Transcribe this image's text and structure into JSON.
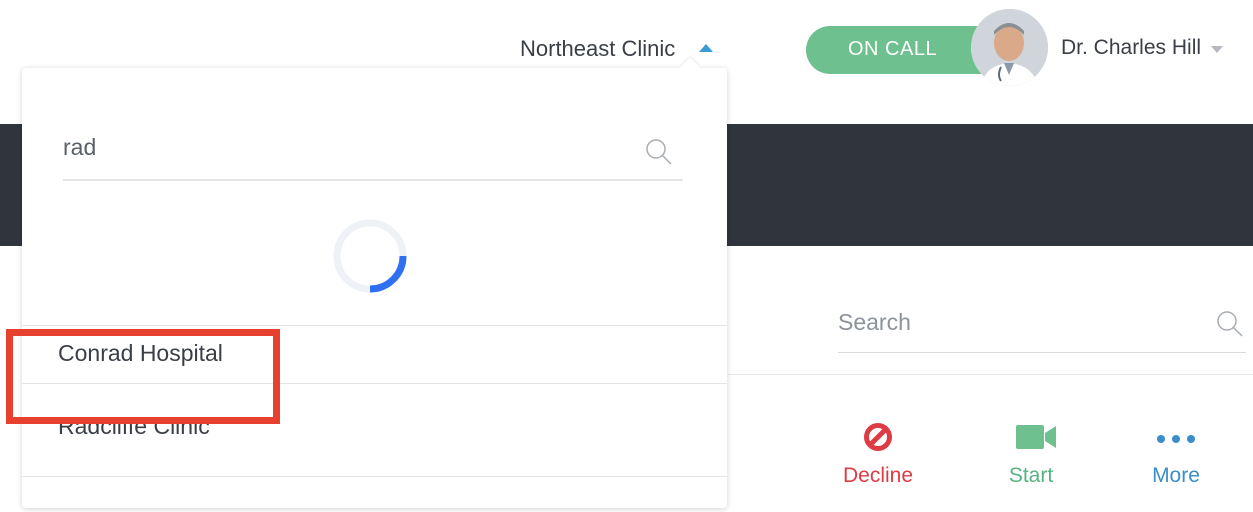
{
  "header": {
    "clinic_selector": {
      "selected": "Northeast Clinic"
    },
    "on_call_label": "ON CALL",
    "user_name": "Dr. Charles Hill"
  },
  "clinic_dropdown": {
    "search_value": "rad",
    "options": [
      {
        "label": "Conrad Hospital"
      },
      {
        "label": "Radcliffe Clinic"
      }
    ]
  },
  "main": {
    "search": {
      "placeholder": "Search"
    },
    "actions": [
      {
        "label": "Decline",
        "icon": "block-icon",
        "color": "#de3c44"
      },
      {
        "label": "Start",
        "icon": "video-camera-icon",
        "color": "#56b381"
      },
      {
        "label": "More",
        "icon": "ellipsis-icon",
        "color": "#3b8ec8"
      }
    ]
  },
  "colors": {
    "header_band": "#30353d",
    "on_call": "#6fc08f",
    "accent_blue": "#3b9bd6",
    "highlight": "#e8402e"
  }
}
